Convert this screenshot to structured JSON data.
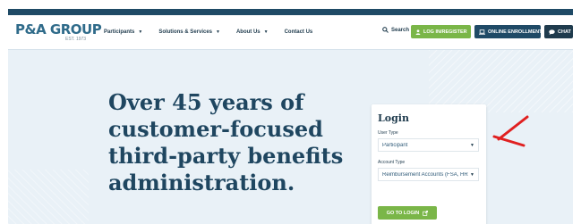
{
  "header": {
    "logo": {
      "name": "P&A GROUP",
      "tagline": "EST. 1973"
    },
    "nav": [
      {
        "label": "Participants",
        "dropdown": true
      },
      {
        "label": "Solutions & Services",
        "dropdown": true
      },
      {
        "label": "About Us",
        "dropdown": true
      },
      {
        "label": "Contact Us",
        "dropdown": false
      }
    ],
    "search_label": "Search",
    "buttons": {
      "login": "LOG IN/REGISTER",
      "enroll": "ONLINE ENROLLMENT",
      "chat": "CHAT"
    }
  },
  "hero": {
    "headline_lines": [
      "Over 45 years of",
      "customer-focused",
      "third-party benefits",
      "administration."
    ]
  },
  "login_card": {
    "title": "Login",
    "user_type_label": "User Type",
    "user_type_value": "Participant",
    "account_type_label": "Account Type",
    "account_type_value": "Reimbursement Accounts (FSA, HRA,",
    "button": "GO TO LOGIN"
  },
  "colors": {
    "brand_dark": "#1f4a66",
    "accent_green": "#7ab648",
    "annotation_red": "#e02020",
    "hero_bg": "#e9f1f7"
  }
}
